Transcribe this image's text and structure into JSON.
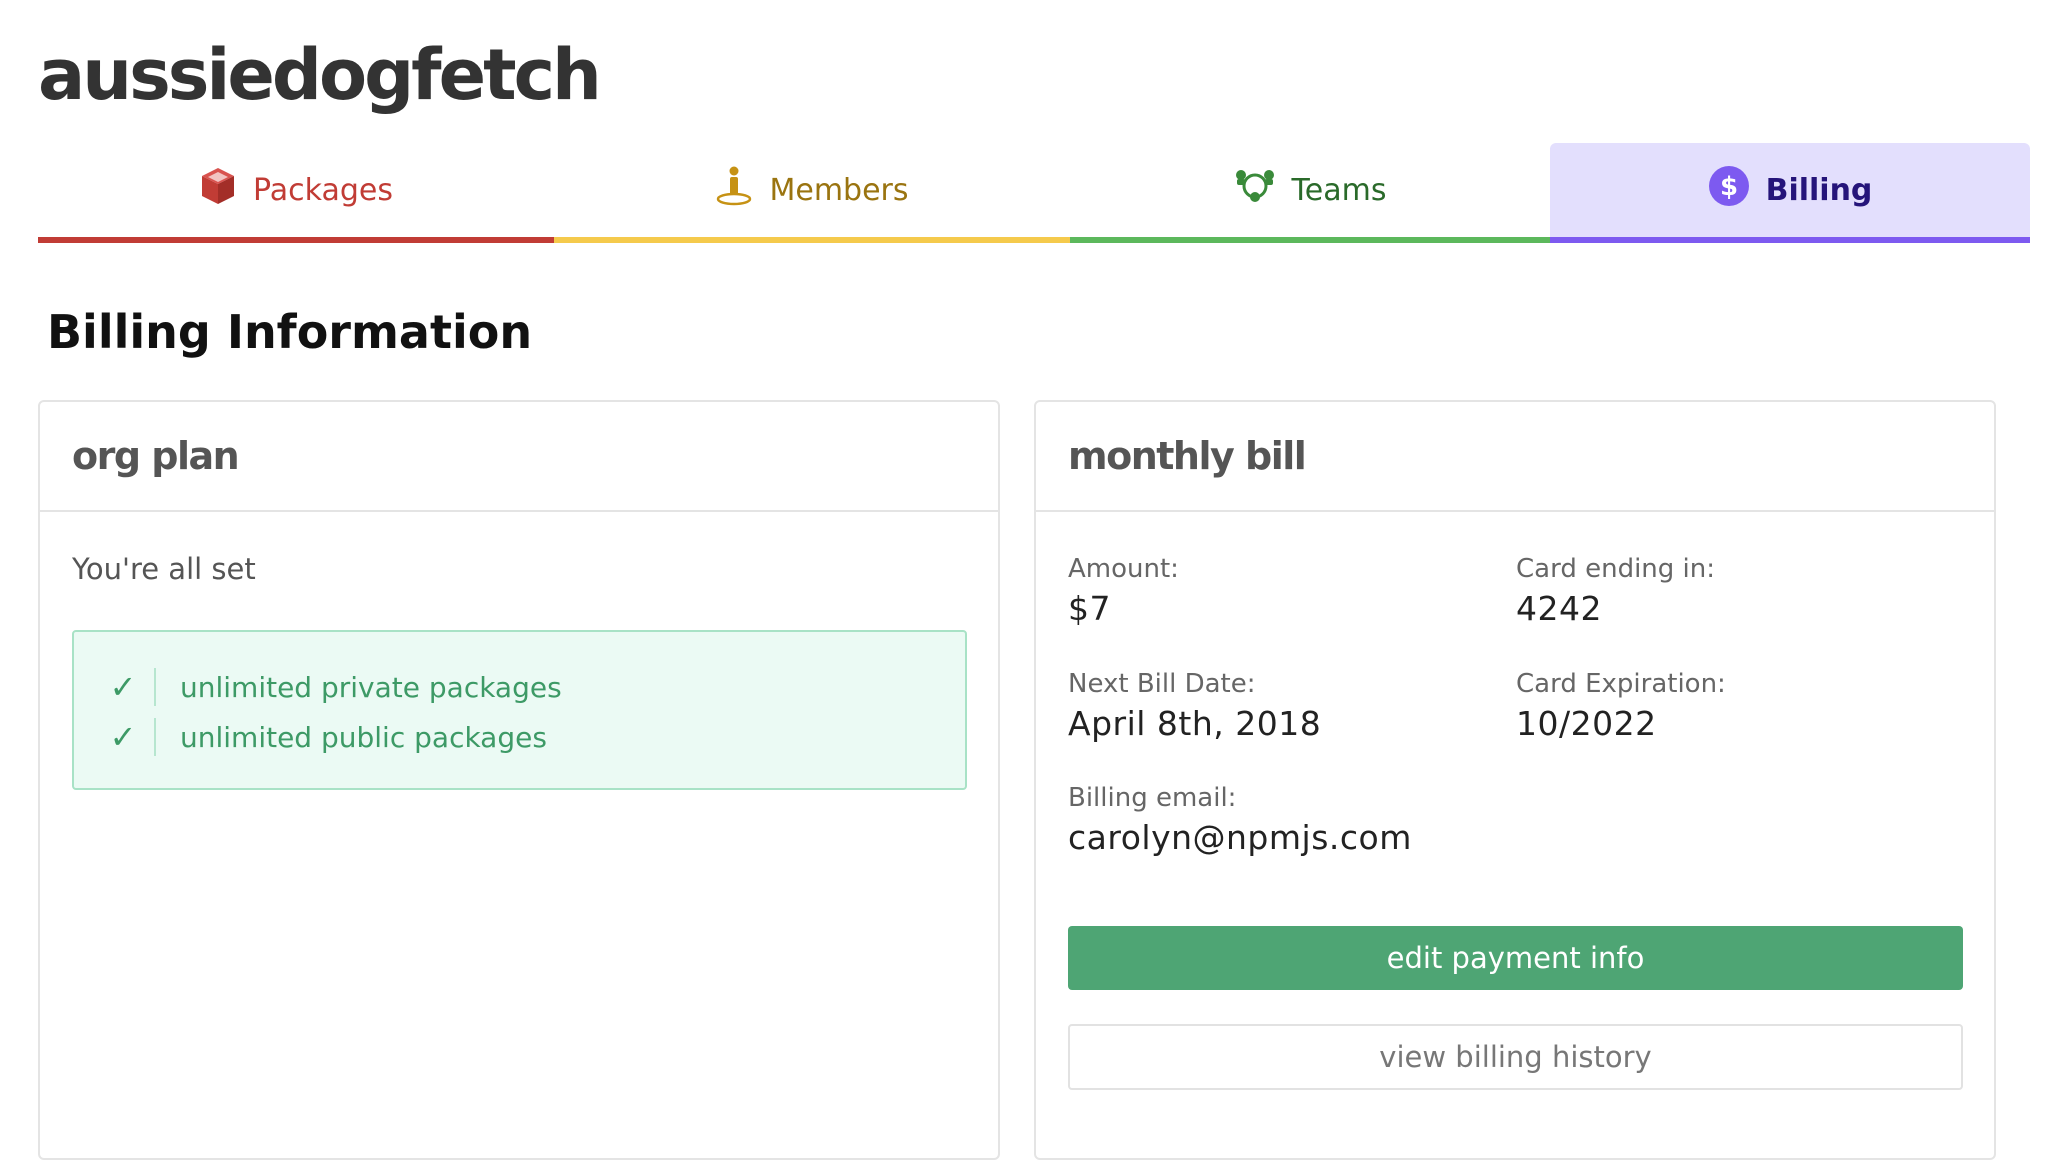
{
  "org": {
    "name": "aussiedogfetch"
  },
  "tabs": [
    {
      "label": "Packages",
      "icon": "package-cube-icon",
      "color": "#c13c35"
    },
    {
      "label": "Members",
      "icon": "person-icon",
      "color": "#f5ca4c"
    },
    {
      "label": "Teams",
      "icon": "team-icon",
      "color": "#5cb85c"
    },
    {
      "label": "Billing",
      "icon": "dollar-circle-icon",
      "color": "#7d5af0",
      "active": true
    }
  ],
  "section": {
    "title": "Billing Information"
  },
  "org_plan": {
    "header": "org plan",
    "status": "You're all set",
    "features": [
      "unlimited private packages",
      "unlimited public packages"
    ]
  },
  "monthly_bill": {
    "header": "monthly bill",
    "amount_label": "Amount:",
    "amount_value": "$7",
    "card_label": "Card ending in:",
    "card_value": "4242",
    "next_bill_label": "Next Bill Date:",
    "next_bill_value": "April 8th, 2018",
    "card_exp_label": "Card Expiration:",
    "card_exp_value": "10/2022",
    "email_label": "Billing email:",
    "email_value": "carolyn@npmjs.com",
    "edit_button": "edit payment info",
    "history_button": "view billing history"
  },
  "colors": {
    "accent_green": "#4ea574",
    "billing_purple": "#7d5af0",
    "packages_red": "#c13c35",
    "members_yellow": "#f5ca4c",
    "teams_green": "#5cb85c"
  }
}
